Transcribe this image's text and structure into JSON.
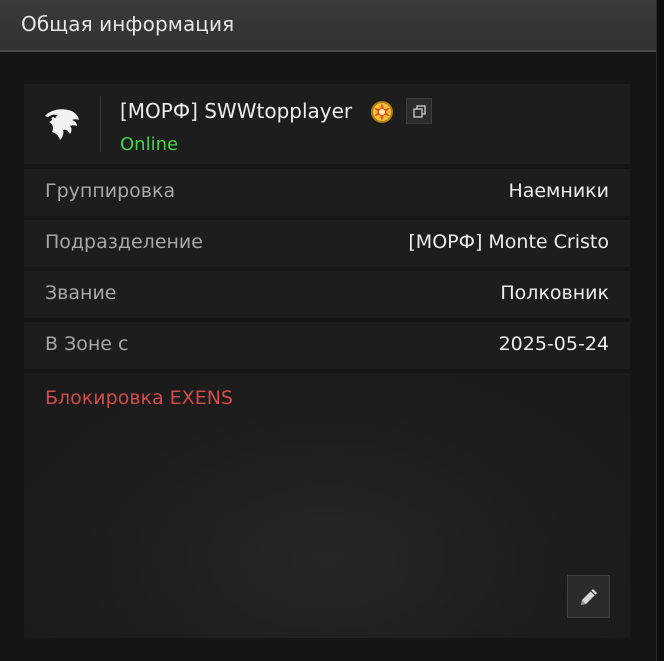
{
  "header": {
    "title": "Общая информация"
  },
  "profile": {
    "logo_icon": "eagle-head-icon",
    "name": "[МОРФ] SWWtopplayer",
    "medal_icon": "medal-badge-icon",
    "copy_icon": "copy-icon",
    "status": "Online",
    "status_color": "#3fd34a"
  },
  "rows": [
    {
      "label": "Группировка",
      "value": "Наемники"
    },
    {
      "label": "Подразделение",
      "value": "[МОРФ] Monte Cristo"
    },
    {
      "label": "Звание",
      "value": "Полковник"
    },
    {
      "label": "В Зоне с",
      "value": "2025-05-24"
    }
  ],
  "notes": {
    "text": "Блокировка EXENS",
    "text_color": "#d24a4a",
    "edit_icon": "pencil-icon"
  }
}
